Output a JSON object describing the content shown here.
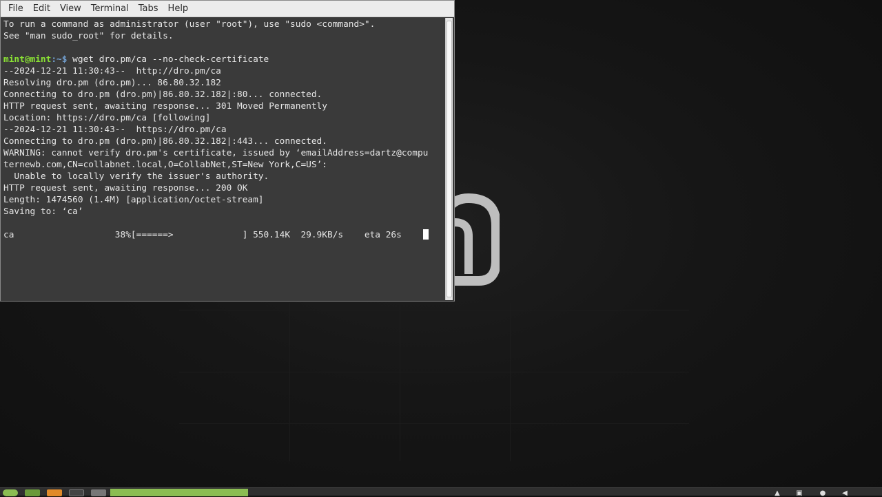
{
  "menu": [
    "File",
    "Edit",
    "View",
    "Terminal",
    "Tabs",
    "Help"
  ],
  "terminal": {
    "lines": [
      "To run a command as administrator (user \"root\"), use \"sudo <command>\".",
      "See \"man sudo_root\" for details.",
      "",
      "__PROMPT__",
      "--2024-12-21 11:30:43--  http://dro.pm/ca",
      "Resolving dro.pm (dro.pm)... 86.80.32.182",
      "Connecting to dro.pm (dro.pm)|86.80.32.182|:80... connected.",
      "HTTP request sent, awaiting response... 301 Moved Permanently",
      "Location: https://dro.pm/ca [following]",
      "--2024-12-21 11:30:43--  https://dro.pm/ca",
      "Connecting to dro.pm (dro.pm)|86.80.32.182|:443... connected.",
      "WARNING: cannot verify dro.pm's certificate, issued by ‘emailAddress=dartz@compu",
      "ternewb.com,CN=collabnet.local,O=CollabNet,ST=New York,C=US’:",
      "  Unable to locally verify the issuer's authority.",
      "HTTP request sent, awaiting response... 200 OK",
      "Length: 1474560 (1.4M) [application/octet-stream]",
      "Saving to: ‘ca’",
      "",
      "__PROGRESS__"
    ],
    "prompt_user": "mint@mint",
    "prompt_sep": ":~$",
    "command": " wget dro.pm/ca --no-check-certificate",
    "progress_line": "ca                   38%[======>             ] 550.14K  29.9KB/s    eta 26s    "
  },
  "colors": {
    "terminal_bg": "#3a3a3a",
    "prompt_user": "#8ae234",
    "prompt_path": "#729fcf",
    "taskbar_active": "#8bbd52"
  },
  "icons": [
    "linux-mint-logo",
    "taskbar-menu-icon",
    "taskbar-files-icon",
    "taskbar-terminal-icon",
    "network-icon",
    "volume-icon"
  ]
}
